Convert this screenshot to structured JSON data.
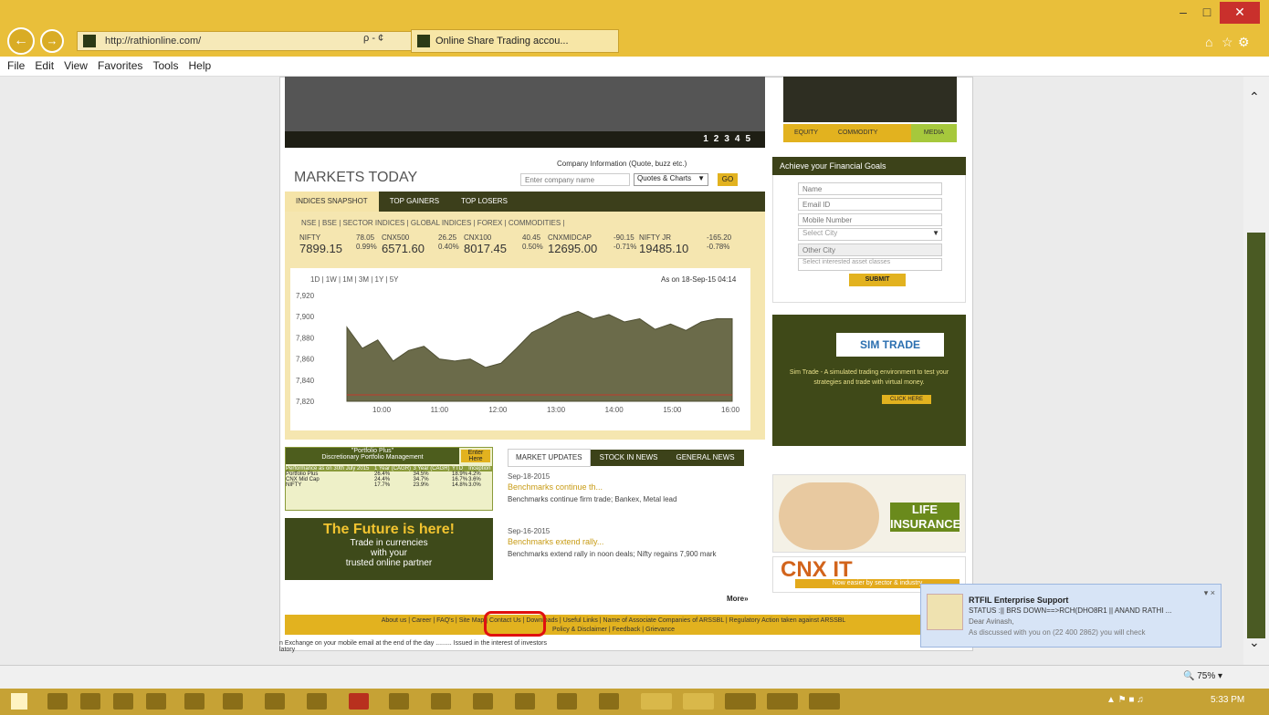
{
  "browser": {
    "url": "http://rathionline.com/",
    "tab_title": "Online Share Trading accou...",
    "search_hint": "ρ - ¢",
    "menu": [
      "File",
      "Edit",
      "View",
      "Favorites",
      "Tools",
      "Help"
    ],
    "window_buttons": [
      "–",
      "□",
      "✕"
    ],
    "zoom": "75%",
    "tray_time": "5:33 PM"
  },
  "carousel": {
    "pages": [
      "1",
      "2",
      "3",
      "4",
      "5"
    ],
    "tabs": [
      "EQUITY",
      "COMMODITY",
      "MEDIA"
    ]
  },
  "markets": {
    "title": "MARKETS TODAY",
    "company_info_label": "Company Information (Quote, buzz etc.)",
    "company_placeholder": "Enter company name",
    "select_value": "Quotes & Charts",
    "go_label": "GO",
    "tabs": [
      "INDICES SNAPSHOT",
      "TOP GAINERS",
      "TOP LOSERS"
    ],
    "subtabs": "NSE | BSE | SECTOR INDICES | GLOBAL INDICES | FOREX | COMMODITIES |",
    "tickers": [
      {
        "name": "NIFTY",
        "change": "78.05",
        "pct": "0.99%",
        "value": "7899.15"
      },
      {
        "name": "CNX500",
        "change": "26.25",
        "pct": "0.40%",
        "value": "6571.60"
      },
      {
        "name": "CNX100",
        "change": "40.45",
        "pct": "0.50%",
        "value": "8017.45"
      },
      {
        "name": "CNXMIDCAP",
        "change": "-90.15",
        "pct": "-0.71%",
        "value": "12695.00"
      },
      {
        "name": "NIFTY JR",
        "change": "-165.20",
        "pct": "-0.78%",
        "value": "19485.10"
      }
    ],
    "range_links": "1D | 1W | 1M | 3M | 1Y | 5Y",
    "as_on": "As on 18-Sep-15 04:14"
  },
  "chart_data": {
    "type": "area",
    "ylim": [
      7820,
      7920
    ],
    "yticks": [
      "7,920",
      "7,900",
      "7,880",
      "7,860",
      "7,840",
      "7,820"
    ],
    "xticks": [
      "10:00",
      "11:00",
      "12:00",
      "13:00",
      "14:00",
      "15:00",
      "16:00"
    ],
    "x": [
      0,
      4,
      8,
      12,
      16,
      20,
      24,
      28,
      32,
      36,
      40,
      44,
      48,
      52,
      56,
      60,
      64,
      68,
      72,
      76,
      80,
      84,
      88,
      92,
      96,
      100
    ],
    "values": [
      7890,
      7870,
      7878,
      7858,
      7868,
      7872,
      7860,
      7858,
      7860,
      7852,
      7856,
      7870,
      7885,
      7892,
      7900,
      7905,
      7898,
      7902,
      7895,
      7898,
      7888,
      7893,
      7887,
      7895,
      7898,
      7898
    ],
    "baseline": 7826
  },
  "advisory": {
    "title": "\"Portfolio Plus\"",
    "subtitle": "Discretionary Portfolio Management",
    "enter_label": "Enter Here",
    "header": [
      "Performance as on 30th July 2015",
      "1 Year (CAGR)",
      "3 Year (CAGR)",
      "YTD",
      "Inception"
    ],
    "rows": [
      [
        "Portfolio Plus",
        "26.4%",
        "34.5%",
        "18.9%",
        "4.2%"
      ],
      [
        "CNX Mid Cap",
        "24.4%",
        "34.7%",
        "16.7%",
        "3.6%"
      ],
      [
        "NIFTY",
        "17.7%",
        "23.9%",
        "14.8%",
        "3.0%"
      ]
    ]
  },
  "future_banner": {
    "headline": "The Future is here!",
    "line1": "Trade in currencies",
    "line2": "with your",
    "line3": "trusted online partner"
  },
  "updates": {
    "tabs": [
      "MARKET UPDATES",
      "STOCK IN NEWS",
      "GENERAL NEWS"
    ],
    "items": [
      {
        "date": "Sep-18-2015",
        "headline": "Benchmarks continue th...",
        "body": "Benchmarks continue firm trade; Bankex, Metal lead"
      },
      {
        "date": "Sep-16-2015",
        "headline": "Benchmarks extend rally...",
        "body": "Benchmarks extend rally in noon deals; Nifty regains 7,900 mark"
      }
    ],
    "more": "More»"
  },
  "goals": {
    "title": "Achieve your Financial Goals",
    "fields": [
      "Name",
      "Email ID",
      "Mobile Number",
      "Select City",
      "Other City",
      "Select interested asset classes"
    ],
    "submit": "SUBMIT"
  },
  "simtrade": {
    "logo": "SIM TRADE",
    "desc": "Sim Trade - A simulated trading environment to test your strategies and trade with virtual money.",
    "cta": "CLICK HERE"
  },
  "insurance": {
    "text": "LIFE INSURANCE"
  },
  "cnx": {
    "text": "CNX IT",
    "sub": "Now easier by sector & industry"
  },
  "footer": {
    "links": "About us | Career | FAQ's | Site Map | Contact Us | Downloads | Useful Links | Name of Associate Companies of ARSSBL | Regulatory Action taken against ARSSBL",
    "links2": "Policy & Disclaimer | Feedback | Grievance",
    "note": "n Exchange on your mobile email at the end of the day ......... Issued in the interest of investors",
    "note2": "latory"
  },
  "notification": {
    "title": "RTFIL Enterprise Support",
    "status": "STATUS :|| BRS DOWN==>RCH(DHO8R1 || ANAND RATHI ...",
    "line2": "Dear Avinash,",
    "line3": "As discussed with you on (22 400 2862) you will check"
  }
}
